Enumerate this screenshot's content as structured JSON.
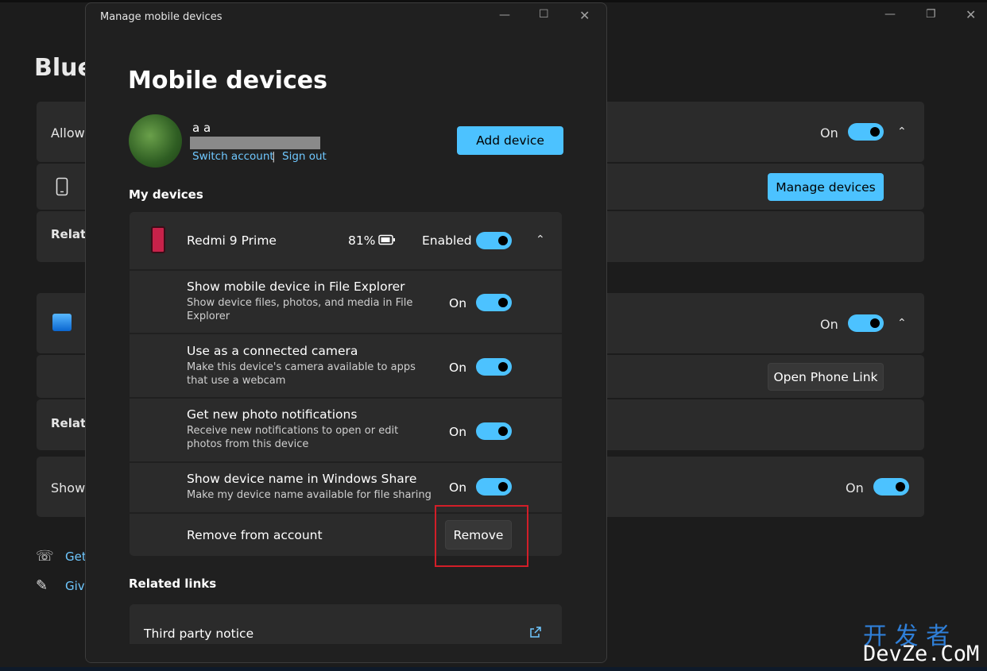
{
  "background_window": {
    "title": "Bluet",
    "allow_row_label": "Allow",
    "allow_state": "On",
    "manage_devices_button": "Manage devices",
    "related_label_1": "Relate",
    "phone_link_state": "On",
    "open_phone_link_button": "Open Phone Link",
    "related_label_2": "Relate",
    "show_row_label": "Show",
    "show_row_state": "On",
    "get_help_link": "Get",
    "give_feedback_link": "Give"
  },
  "dialog": {
    "window_title": "Manage mobile devices",
    "heading": "Mobile devices",
    "account": {
      "name": "a a",
      "switch_account": "Switch account",
      "separator": "|",
      "sign_out": "Sign out"
    },
    "add_device_button": "Add device",
    "my_devices_label": "My devices",
    "device": {
      "name": "Redmi 9 Prime",
      "battery": "81%",
      "status": "Enabled"
    },
    "settings": [
      {
        "title": "Show mobile device in File Explorer",
        "desc": "Show device files, photos, and media in File Explorer",
        "state": "On"
      },
      {
        "title": "Use as a connected camera",
        "desc": "Make this device's camera available to apps that use a webcam",
        "state": "On"
      },
      {
        "title": "Get new photo notifications",
        "desc": "Receive new notifications to open or edit photos from this device",
        "state": "On"
      },
      {
        "title": "Show device name in Windows Share",
        "desc": "Make my device name available for file sharing",
        "state": "On"
      }
    ],
    "remove_row": {
      "label": "Remove from account",
      "button": "Remove"
    },
    "related_links_label": "Related links",
    "third_party_notice": "Third party notice"
  },
  "watermark": {
    "cn": "开 发 者",
    "en": "DevZe.CoM"
  },
  "colors": {
    "accent": "#4cc2ff",
    "highlight_box": "#d21e28"
  }
}
